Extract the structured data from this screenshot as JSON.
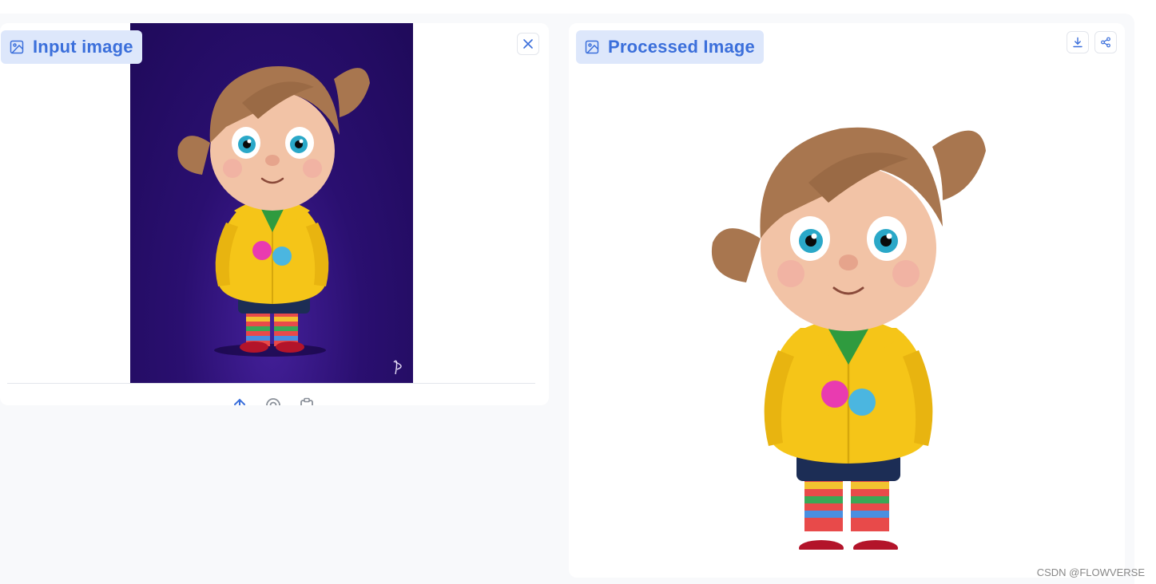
{
  "input_panel": {
    "label": "Input image",
    "label_icon": "image-icon",
    "close_icon": "close-icon",
    "source_icons": [
      "upload-icon",
      "webcam-icon",
      "clipboard-icon"
    ]
  },
  "output_panel": {
    "label": "Processed Image",
    "label_icon": "image-icon",
    "download_icon": "download-icon",
    "share_icon": "share-icon"
  },
  "watermark": "CSDN @FLOWVERSE",
  "colors": {
    "accent": "#3b6fdb",
    "chip_bg": "#dde7fb",
    "input_bg": "#2a0f70",
    "panel_bg": "#ffffff",
    "page_bg": "#f8f9fb"
  }
}
